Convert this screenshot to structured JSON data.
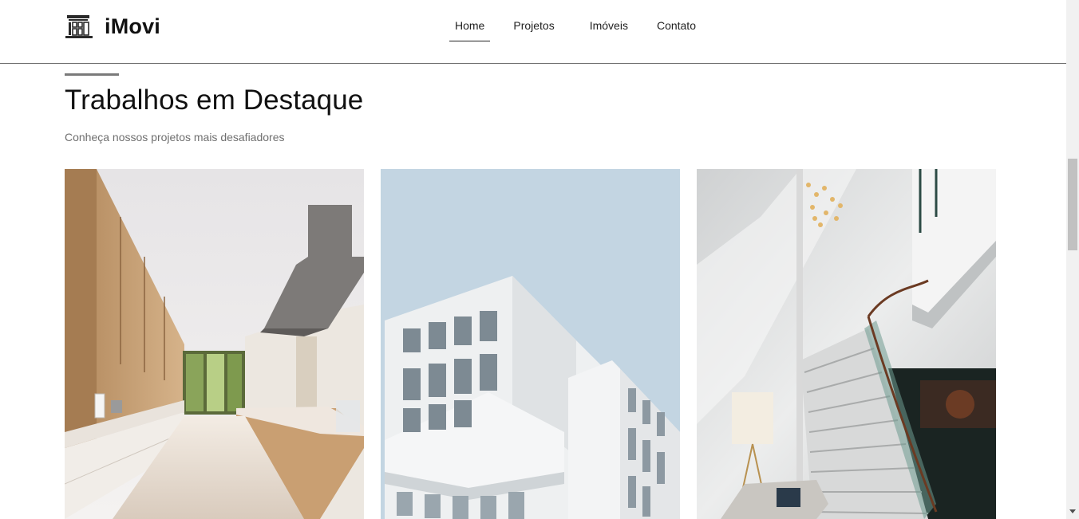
{
  "brand": {
    "name": "iMovi",
    "icon": "building-logo-icon"
  },
  "nav": {
    "items": [
      {
        "label": "Home",
        "active": true
      },
      {
        "label": "Projetos",
        "active": false
      },
      {
        "label": "Imóveis",
        "active": false
      },
      {
        "label": "Contato",
        "active": false
      }
    ]
  },
  "section": {
    "title": "Trabalhos em Destaque",
    "subtitle": "Conheça nossos projetos mais desafiadores"
  },
  "projects": [
    {
      "image": "kitchen-interior-photo"
    },
    {
      "image": "white-modern-building-photo"
    },
    {
      "image": "staircase-lobby-photo"
    }
  ],
  "colors": {
    "text": "#111111",
    "subtitle": "#6f6f6f",
    "divider": "#6b6b6b",
    "accent_bar": "#7a7a7a"
  }
}
